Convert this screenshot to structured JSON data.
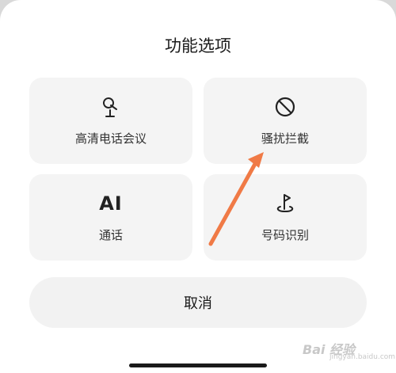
{
  "dialog": {
    "title": "功能选项",
    "options": [
      {
        "label": "高清电话会议",
        "icon": "satellite-dish-icon"
      },
      {
        "label": "骚扰拦截",
        "icon": "block-icon"
      },
      {
        "label": "通话",
        "icon_text": "AI"
      },
      {
        "label": "号码识别",
        "icon": "location-flag-icon"
      }
    ],
    "cancel_label": "取消"
  },
  "annotation": {
    "arrow_color": "#f07a46"
  },
  "watermark": {
    "text": "Bai 经验",
    "sub": "jingyan.baidu.com"
  }
}
